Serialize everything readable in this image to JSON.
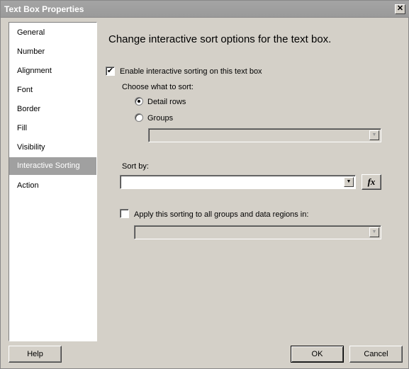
{
  "window": {
    "title": "Text Box Properties",
    "close": "✕"
  },
  "sidebar": {
    "items": [
      {
        "label": "General"
      },
      {
        "label": "Number"
      },
      {
        "label": "Alignment"
      },
      {
        "label": "Font"
      },
      {
        "label": "Border"
      },
      {
        "label": "Fill"
      },
      {
        "label": "Visibility"
      },
      {
        "label": "Interactive Sorting",
        "selected": true
      },
      {
        "label": "Action"
      }
    ]
  },
  "main": {
    "heading": "Change interactive sort options for the text box.",
    "enable_label": "Enable interactive sorting on this text box",
    "enable_checked": true,
    "choose_label": "Choose what to sort:",
    "radio_detail": "Detail rows",
    "radio_groups": "Groups",
    "selected": "Detail rows",
    "groups_value": "",
    "sortby_label": "Sort by:",
    "sortby_value": "",
    "fx": "fx",
    "apply_label": "Apply this sorting to all groups and data regions in:",
    "apply_checked": false,
    "apply_value": ""
  },
  "footer": {
    "help": "Help",
    "ok": "OK",
    "cancel": "Cancel"
  }
}
